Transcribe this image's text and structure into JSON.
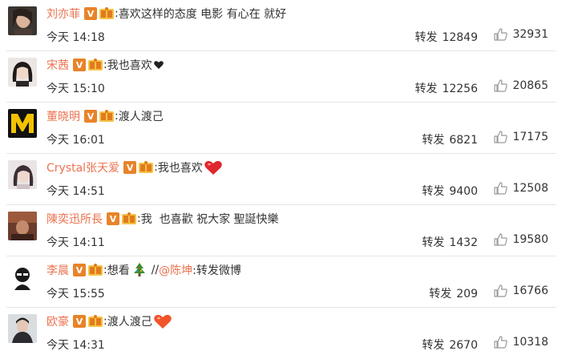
{
  "comments": [
    {
      "user": "刘亦菲",
      "text": "喜欢这样的态度 电影 有心在 就好",
      "time": "今天 14:18",
      "repost_label": "转发",
      "reposts": "12849",
      "likes": "32931",
      "emoji": ""
    },
    {
      "user": "宋茜",
      "text": "我也喜欢",
      "time": "今天 15:10",
      "repost_label": "转发",
      "reposts": "12256",
      "likes": "20865",
      "emoji": "black-heart"
    },
    {
      "user": "董晓明",
      "text": "渡人渡己",
      "time": "今天 16:01",
      "repost_label": "转发",
      "reposts": "6821",
      "likes": "17175",
      "emoji": ""
    },
    {
      "user": "Crystal张天爱",
      "text": "我也喜欢",
      "time": "今天 14:51",
      "repost_label": "转发",
      "reposts": "9400",
      "likes": "12508",
      "emoji": "red-heart"
    },
    {
      "user": "陳奕迅所長",
      "text": "我  也喜歡 祝大家 聖誕快樂",
      "time": "今天 14:11",
      "repost_label": "转发",
      "reposts": "1432",
      "likes": "19580",
      "emoji": ""
    },
    {
      "user": "李晨",
      "text": "想看",
      "quote_prefix": "//",
      "mention": "@陈坤",
      "quote_text": ":转发微博",
      "time": "今天 15:55",
      "repost_label": "转发",
      "reposts": "209",
      "likes": "16766",
      "emoji": "christmas-tree"
    },
    {
      "user": "欧豪",
      "text": "渡人渡己",
      "time": "今天 14:31",
      "repost_label": "转发",
      "reposts": "2670",
      "likes": "10318",
      "emoji": "orange-heart"
    }
  ],
  "badges": {
    "verified": "V",
    "colon": ":"
  },
  "colors": {
    "username": "#eb7350",
    "verified_badge": "#e8832a",
    "text": "#333333",
    "divider": "#e6e6e6"
  }
}
